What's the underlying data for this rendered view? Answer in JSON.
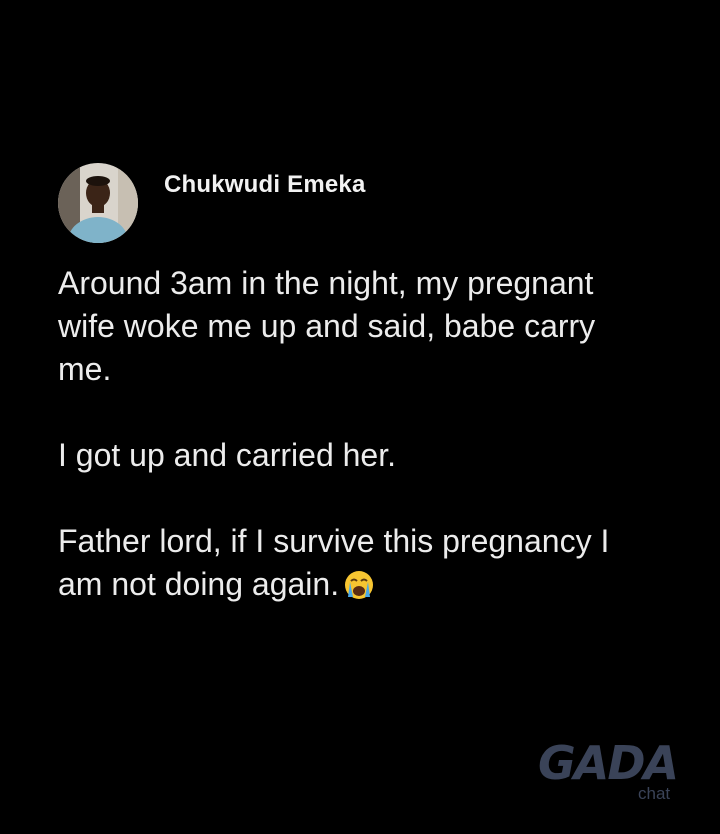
{
  "post": {
    "author_name": "Chukwudi Emeka",
    "avatar_icon": "profile-photo",
    "paragraphs": [
      "Around 3am in the night, my pregnant\nwife woke me up and said, babe carry\nme.",
      "I got up and carried her.",
      "Father lord, if I survive this pregnancy I\nam not doing again."
    ],
    "end_emoji": "loudly-crying-face-icon"
  },
  "watermark": {
    "brand": "GADA",
    "sub": "chat"
  },
  "colors": {
    "background": "#000000",
    "text": "#ececec",
    "watermark": "#3a4358"
  }
}
